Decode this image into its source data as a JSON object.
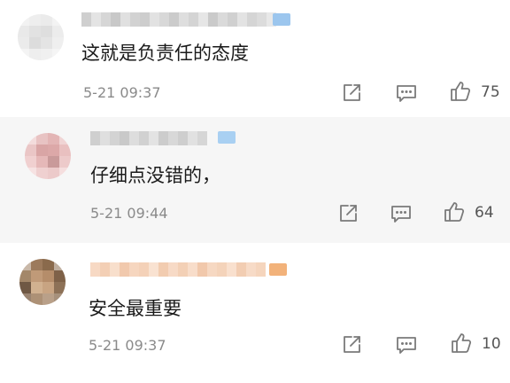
{
  "comments": [
    {
      "text": "这就是负责任的态度",
      "time": "5-21 09:37",
      "likes": "75",
      "username_obscured": true,
      "colors": {
        "username_pixels": "#d9d9d9",
        "badge": "#9cc6ee"
      }
    },
    {
      "text": "仔细点没错的，",
      "time": "5-21 09:44",
      "likes": "64",
      "username_obscured": true,
      "colors": {
        "username_pixels": "#d9d9d9",
        "badge": "#a9d0f2"
      }
    },
    {
      "text": "安全最重要",
      "time": "5-21 09:37",
      "likes": "10",
      "username_obscured": true,
      "colors": {
        "username_pixels": "#f5d2b8",
        "badge": "#f2b27a"
      }
    }
  ],
  "icons": {
    "share": "share-icon",
    "reply": "comment-icon",
    "like": "thumbs-up-icon"
  }
}
